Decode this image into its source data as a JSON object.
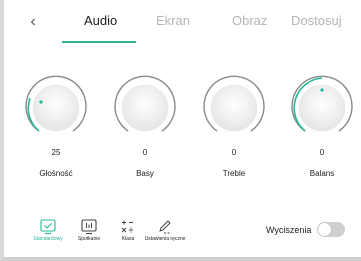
{
  "tabs": [
    {
      "label": "Audio",
      "active": true
    },
    {
      "label": "Ekran",
      "active": false
    },
    {
      "label": "Obraz",
      "active": false
    },
    {
      "label": "Dostosuj",
      "active": false
    }
  ],
  "knobs": [
    {
      "name": "volume",
      "value": "25",
      "label": "Głośność"
    },
    {
      "name": "bass",
      "value": "0",
      "label": "Basy"
    },
    {
      "name": "treble",
      "value": "0",
      "label": "Treble"
    },
    {
      "name": "balance",
      "value": "0",
      "label": "Balans"
    }
  ],
  "presets": [
    {
      "label": "Standardowy",
      "icon": "check-screen-icon",
      "active": true
    },
    {
      "label": "Spotkanie",
      "icon": "equalizer-icon",
      "active": false
    },
    {
      "label": "Klasa",
      "icon": "math-symbols-icon",
      "active": false
    },
    {
      "label": "Ustawienia ręczne",
      "icon": "pen-icon",
      "active": false
    }
  ],
  "noise_cancellation": {
    "label": "Wyciszenia",
    "enabled": false
  },
  "colors": {
    "accent": "#2ab59a",
    "inactive_text": "#b5b5b5",
    "toggle_off": "#cfcfcf"
  }
}
